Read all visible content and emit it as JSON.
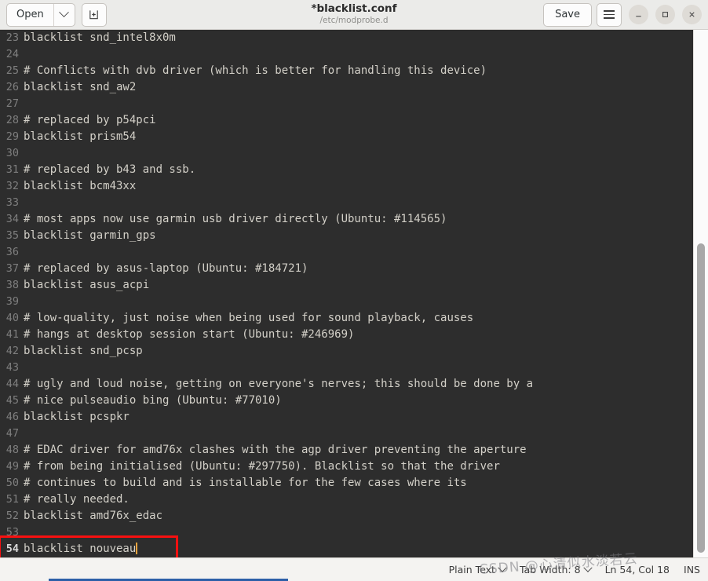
{
  "window": {
    "title": "*blacklist.conf",
    "subtitle": "/etc/modprobe.d"
  },
  "toolbar": {
    "open_label": "Open",
    "open_dropdown_icon": "chevron-down-icon",
    "new_document_icon": "new-document-icon",
    "save_label": "Save",
    "menu_icon": "hamburger-menu-icon",
    "minimize_icon": "minimize-icon",
    "maximize_icon": "maximize-icon",
    "close_icon": "close-icon"
  },
  "editor": {
    "first_visible_line": 23,
    "lines": [
      {
        "n": "23",
        "text": "blacklist snd_intel8x0m"
      },
      {
        "n": "24",
        "text": ""
      },
      {
        "n": "25",
        "text": "# Conflicts with dvb driver (which is better for handling this device)"
      },
      {
        "n": "26",
        "text": "blacklist snd_aw2"
      },
      {
        "n": "27",
        "text": ""
      },
      {
        "n": "28",
        "text": "# replaced by p54pci"
      },
      {
        "n": "29",
        "text": "blacklist prism54"
      },
      {
        "n": "30",
        "text": ""
      },
      {
        "n": "31",
        "text": "# replaced by b43 and ssb."
      },
      {
        "n": "32",
        "text": "blacklist bcm43xx"
      },
      {
        "n": "33",
        "text": ""
      },
      {
        "n": "34",
        "text": "# most apps now use garmin usb driver directly (Ubuntu: #114565)"
      },
      {
        "n": "35",
        "text": "blacklist garmin_gps"
      },
      {
        "n": "36",
        "text": ""
      },
      {
        "n": "37",
        "text": "# replaced by asus-laptop (Ubuntu: #184721)"
      },
      {
        "n": "38",
        "text": "blacklist asus_acpi"
      },
      {
        "n": "39",
        "text": ""
      },
      {
        "n": "40",
        "text": "# low-quality, just noise when being used for sound playback, causes"
      },
      {
        "n": "41",
        "text": "# hangs at desktop session start (Ubuntu: #246969)"
      },
      {
        "n": "42",
        "text": "blacklist snd_pcsp"
      },
      {
        "n": "43",
        "text": ""
      },
      {
        "n": "44",
        "text": "# ugly and loud noise, getting on everyone's nerves; this should be done by a"
      },
      {
        "n": "45",
        "text": "# nice pulseaudio bing (Ubuntu: #77010)"
      },
      {
        "n": "46",
        "text": "blacklist pcspkr"
      },
      {
        "n": "47",
        "text": ""
      },
      {
        "n": "48",
        "text": "# EDAC driver for amd76x clashes with the agp driver preventing the aperture"
      },
      {
        "n": "49",
        "text": "# from being initialised (Ubuntu: #297750). Blacklist so that the driver"
      },
      {
        "n": "50",
        "text": "# continues to build and is installable for the few cases where its"
      },
      {
        "n": "51",
        "text": "# really needed."
      },
      {
        "n": "52",
        "text": "blacklist amd76x_edac"
      },
      {
        "n": "53",
        "text": ""
      },
      {
        "n": "54",
        "text": "blacklist nouveau",
        "current": true,
        "caret": true
      }
    ]
  },
  "statusbar": {
    "language_label": "Plain Text",
    "language_dropdown_icon": "chevron-down-icon",
    "tab_width_label": "Tab Width: 8",
    "tab_width_dropdown_icon": "chevron-down-icon",
    "position_label": "Ln 54, Col 18",
    "insert_mode_label": "INS"
  },
  "annotation": {
    "watermark_text": "CSDN @心清似水淡若云",
    "highlight_color": "#f71010"
  }
}
